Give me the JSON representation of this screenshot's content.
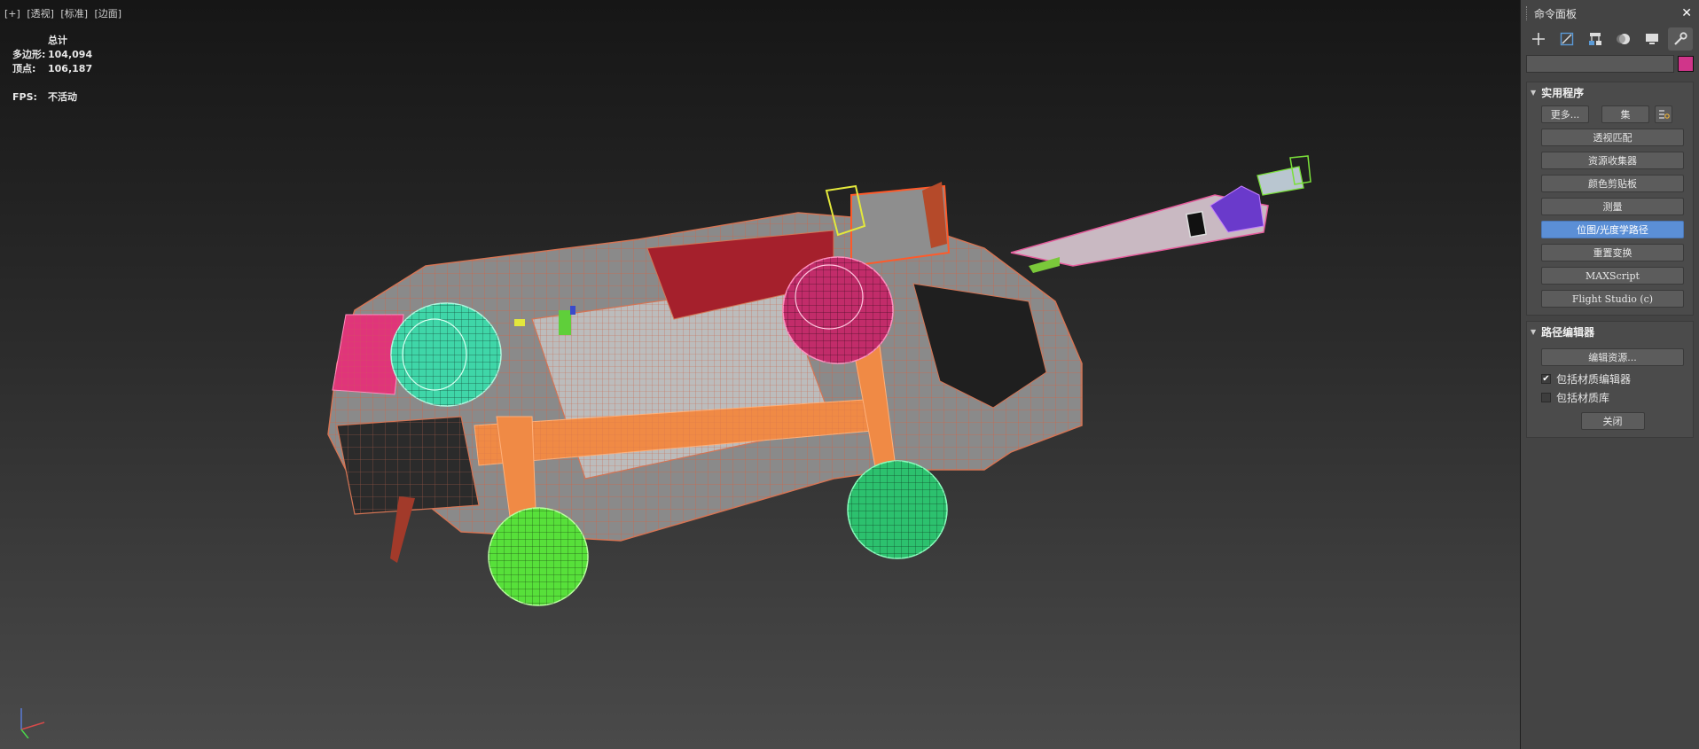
{
  "viewport": {
    "labels": [
      "[+]",
      "[透视]",
      "[标准]",
      "[边面]"
    ],
    "stats": {
      "title": "总计",
      "polygons_label": "多边形:",
      "polygons_value": "104,094",
      "vertices_label": "顶点:",
      "vertices_value": "106,187",
      "fps_label": "FPS:",
      "fps_value": "不活动"
    }
  },
  "panel": {
    "title": "命令面板",
    "close": "✕",
    "tabs": [
      {
        "icon": "create-icon"
      },
      {
        "icon": "modify-icon"
      },
      {
        "icon": "hierarchy-icon"
      },
      {
        "icon": "motion-icon"
      },
      {
        "icon": "display-icon"
      },
      {
        "icon": "utilities-icon"
      }
    ],
    "object_name": "",
    "object_color": "#d0358a",
    "utilities": {
      "title": "实用程序",
      "more": "更多...",
      "sets": "集",
      "buttons": [
        "透视匹配",
        "资源收集器",
        "颜色剪贴板",
        "测量",
        "位图/光度学路径",
        "重置变换",
        "MAXScript",
        "Flight Studio (c)"
      ],
      "active_index": 4
    },
    "path_editor": {
      "title": "路径编辑器",
      "edit_resources": "编辑资源...",
      "include_material_editor": "包括材质编辑器",
      "include_material_editor_checked": true,
      "include_material_library": "包括材质库",
      "include_material_library_checked": false,
      "close": "关闭"
    }
  }
}
